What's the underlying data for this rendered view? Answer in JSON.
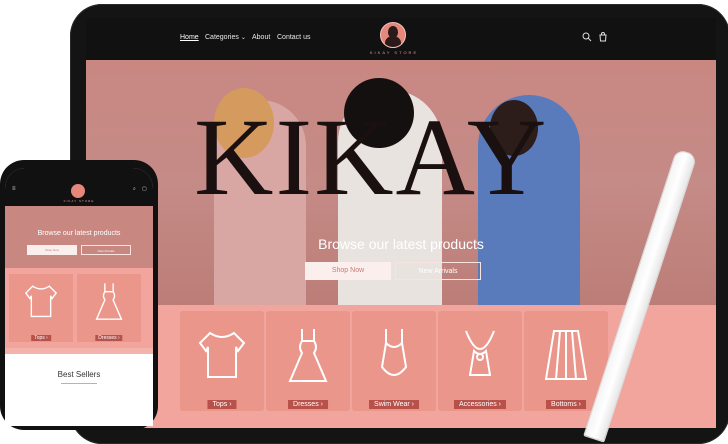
{
  "nav": {
    "items": [
      {
        "label": "Home"
      },
      {
        "label": "Categories"
      },
      {
        "label": "About"
      },
      {
        "label": "Contact us"
      }
    ],
    "brand": "KIKAY STORE",
    "icons": [
      "search-icon",
      "cart-icon"
    ]
  },
  "hero": {
    "word": "KIKAY",
    "title": "Browse our latest products",
    "buttons": [
      {
        "label": "Shop Now"
      },
      {
        "label": "New Arrivals"
      }
    ]
  },
  "categories": [
    {
      "label": "Tops ›",
      "icon": "top-icon"
    },
    {
      "label": "Dresses ›",
      "icon": "dress-icon"
    },
    {
      "label": "Swim Wear ›",
      "icon": "swimwear-icon"
    },
    {
      "label": "Accessories ›",
      "icon": "necklace-icon"
    },
    {
      "label": "Bottoms ›",
      "icon": "skirt-icon"
    }
  ],
  "phone": {
    "brand": "KIKAY STORE",
    "hero_title": "Browse our latest products",
    "buttons": [
      {
        "label": "Shop Now"
      },
      {
        "label": "New Arrivals"
      }
    ],
    "categories": [
      {
        "label": "Tops ›"
      },
      {
        "label": "Dresses ›"
      }
    ],
    "section_title": "Best Sellers"
  },
  "colors": {
    "accent": "#f1a59c",
    "label_bg": "#b7514a",
    "nav_bg": "#111111"
  }
}
